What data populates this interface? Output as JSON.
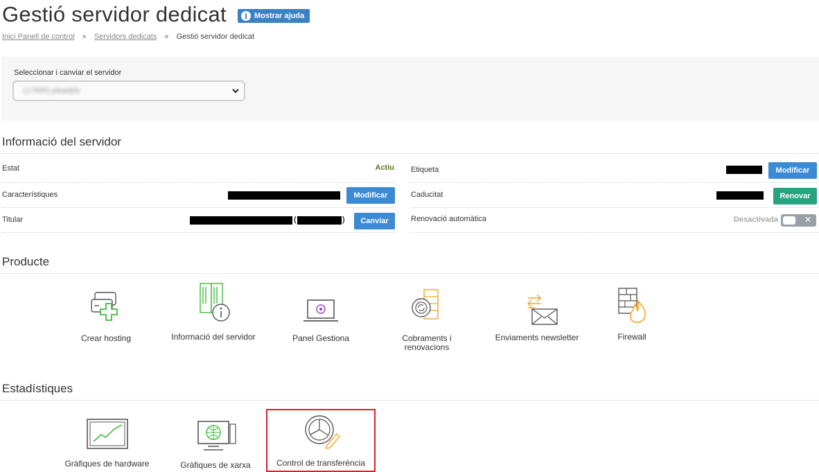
{
  "header": {
    "title": "Gestió servidor dedicat",
    "help_label": "Mostrar ajuda"
  },
  "breadcrumb": {
    "items": [
      "Inici Panell de control",
      "Servidors dedicats",
      "Gestió servidor dedicat"
    ],
    "separator": "»"
  },
  "server_select": {
    "label": "Seleccionar i canviar el servidor",
    "value": "(17895) pleadjdz"
  },
  "server_info": {
    "title": "Informació del servidor",
    "left": [
      {
        "label": "Estat",
        "value": "Actiu"
      },
      {
        "label": "Característiques",
        "button": "Modificar"
      },
      {
        "label": "Titular",
        "paren_open": "(",
        "paren_close": ")",
        "button": "Canviar"
      }
    ],
    "right": [
      {
        "label": "Etiqueta",
        "button": "Modificar"
      },
      {
        "label": "Caducitat",
        "button": "Renovar"
      },
      {
        "label": "Renovació automàtica",
        "value": "Desactivada",
        "toggle_symbol": "✕",
        "toggle_on": false
      }
    ]
  },
  "product": {
    "title": "Producte",
    "items": [
      {
        "label_lines": [
          "Crear hosting"
        ],
        "icon": "server-add-icon"
      },
      {
        "label_lines": [
          "Informació del servidor"
        ],
        "icon": "server-info-icon"
      },
      {
        "label_lines": [
          "Panel Gestiona"
        ],
        "icon": "laptop-panel-icon"
      },
      {
        "label_lines": [
          "Cobraments i",
          "renovacions"
        ],
        "icon": "payments-renewals-icon"
      },
      {
        "label_lines": [
          "Enviaments newsletter"
        ],
        "icon": "newsletter-icon"
      },
      {
        "label_lines": [
          "Firewall"
        ],
        "icon": "firewall-icon"
      }
    ]
  },
  "stats": {
    "title": "Estadístiques",
    "items": [
      {
        "label": "Gràfiques de hardware",
        "icon": "hardware-chart-icon"
      },
      {
        "label": "Gràfiques de xarxa",
        "icon": "network-chart-icon"
      },
      {
        "label": "Control de transferència",
        "icon": "transfer-control-icon",
        "highlighted": true
      }
    ]
  },
  "colors": {
    "accent_blue": "#3b8ad3",
    "renew_green": "#27a37d",
    "icon_green": "#3bbf3b",
    "icon_orange": "#f5a623",
    "highlight_red": "#d62128"
  }
}
